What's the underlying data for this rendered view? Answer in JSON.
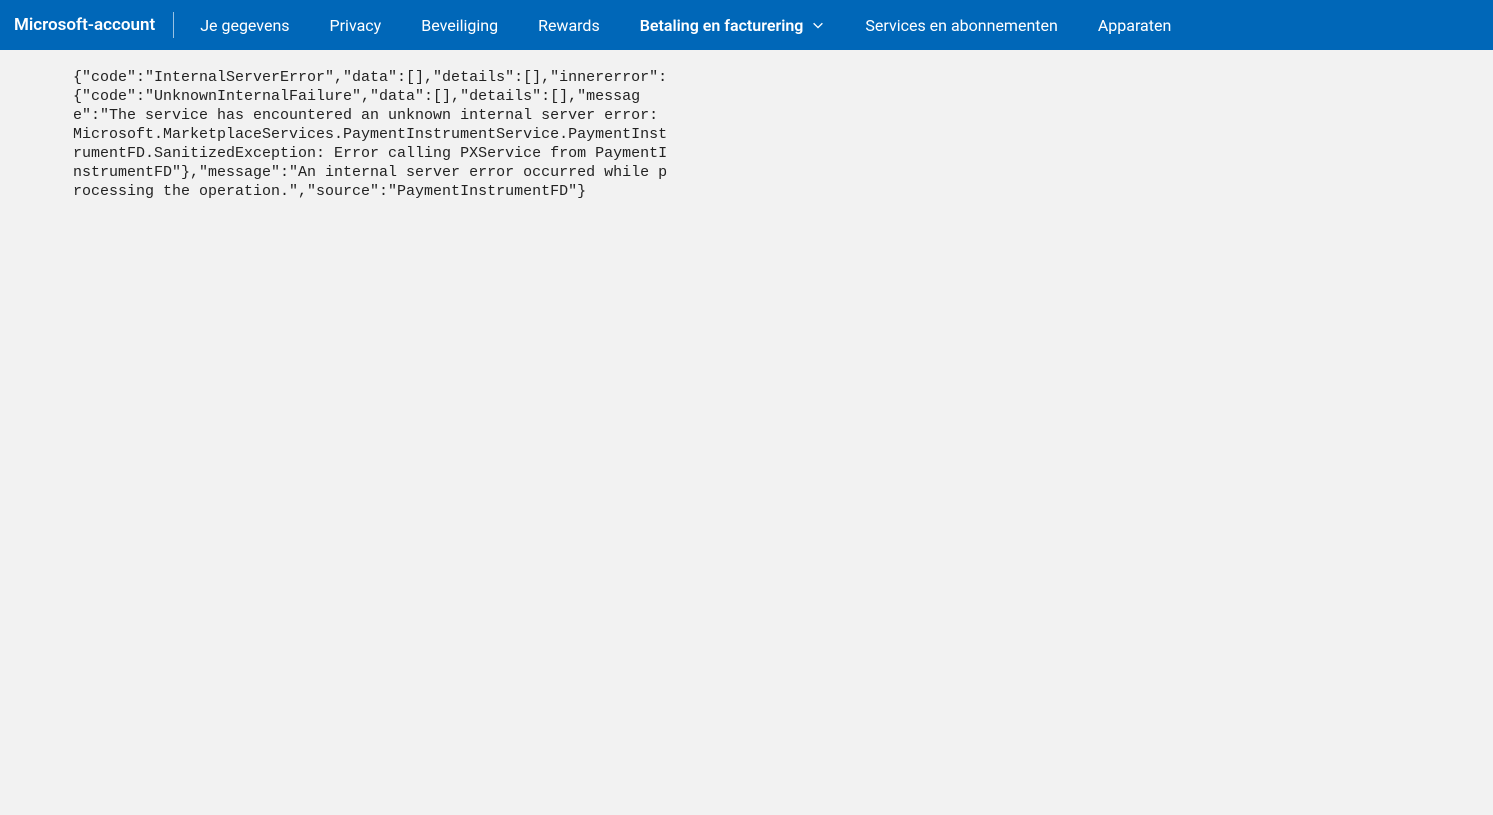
{
  "nav": {
    "brand": "Microsoft-account",
    "items": [
      {
        "label": "Je gegevens",
        "active": false,
        "dropdown": false
      },
      {
        "label": "Privacy",
        "active": false,
        "dropdown": false
      },
      {
        "label": "Beveiliging",
        "active": false,
        "dropdown": false
      },
      {
        "label": "Rewards",
        "active": false,
        "dropdown": false
      },
      {
        "label": "Betaling en facturering",
        "active": true,
        "dropdown": true
      },
      {
        "label": "Services en abonnementen",
        "active": false,
        "dropdown": false
      },
      {
        "label": "Apparaten",
        "active": false,
        "dropdown": false
      }
    ]
  },
  "error_text": "{\"code\":\"InternalServerError\",\"data\":[],\"details\":[],\"innererror\":{\"code\":\"UnknownInternalFailure\",\"data\":[],\"details\":[],\"message\":\"The service has encountered an unknown internal server error: Microsoft.MarketplaceServices.PaymentInstrumentService.PaymentInstrumentFD.SanitizedException: Error calling PXService from PaymentInstrumentFD\"},\"message\":\"An internal server error occurred while processing the operation.\",\"source\":\"PaymentInstrumentFD\"}"
}
